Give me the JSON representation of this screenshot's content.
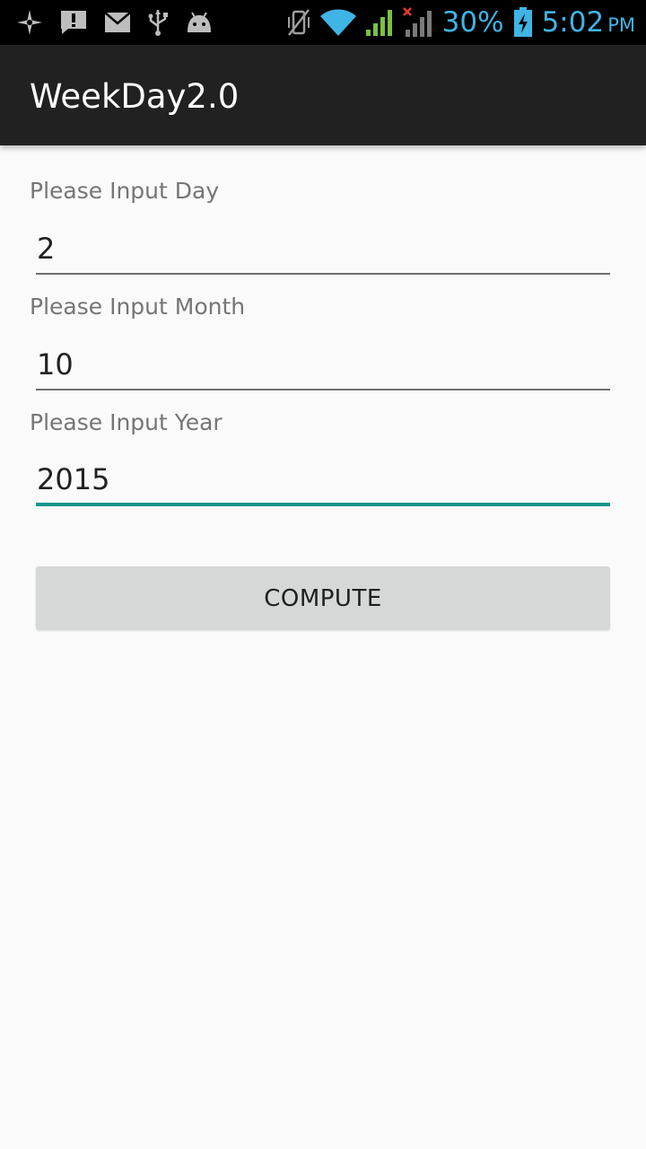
{
  "status_bar": {
    "left_icons": [
      "gps-icon",
      "alert-icon",
      "email-icon",
      "usb-icon",
      "android-debug-icon"
    ],
    "right_icons": [
      "vibrate-muted-icon",
      "wifi-icon",
      "cell-signal-icon",
      "no-signal-icon",
      "battery-charging-icon"
    ],
    "battery_percent": "30%",
    "time": "5:02",
    "ampm": "PM",
    "accent_color": "#3fb5e5"
  },
  "app_bar": {
    "title": "WeekDay2.0"
  },
  "form": {
    "day": {
      "label": "Please Input Day",
      "value": "2"
    },
    "month": {
      "label": "Please Input Month",
      "value": "10"
    },
    "year": {
      "label": "Please Input Year",
      "value": "2015"
    },
    "focus_color": "#169689",
    "compute_label": "COMPUTE"
  }
}
